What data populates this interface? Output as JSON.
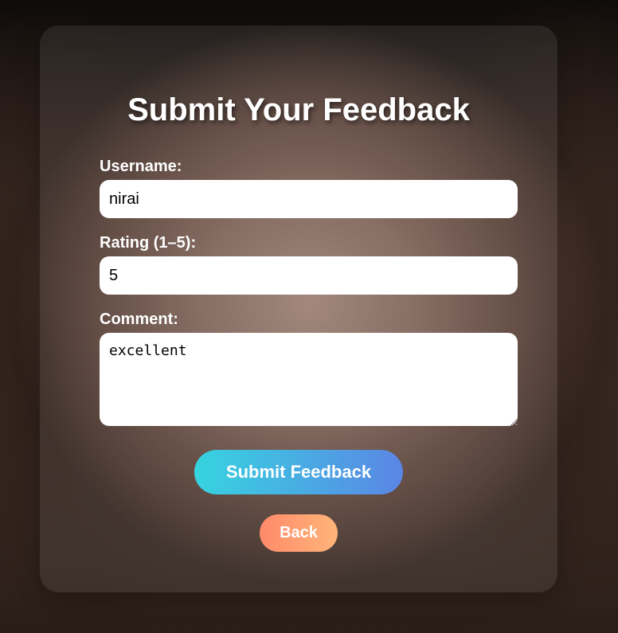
{
  "page": {
    "title": "Submit Your Feedback"
  },
  "form": {
    "username": {
      "label": "Username:",
      "value": "nirai"
    },
    "rating": {
      "label": "Rating (1–5):",
      "value": "5"
    },
    "comment": {
      "label": "Comment:",
      "value": "excellent"
    }
  },
  "actions": {
    "submit_label": "Submit Feedback",
    "back_label": "Back"
  },
  "colors": {
    "submit_gradient_start": "#36d4e0",
    "submit_gradient_end": "#5b86e5",
    "back_gradient_start": "#ff8a6a",
    "back_gradient_end": "#ffb57a"
  }
}
